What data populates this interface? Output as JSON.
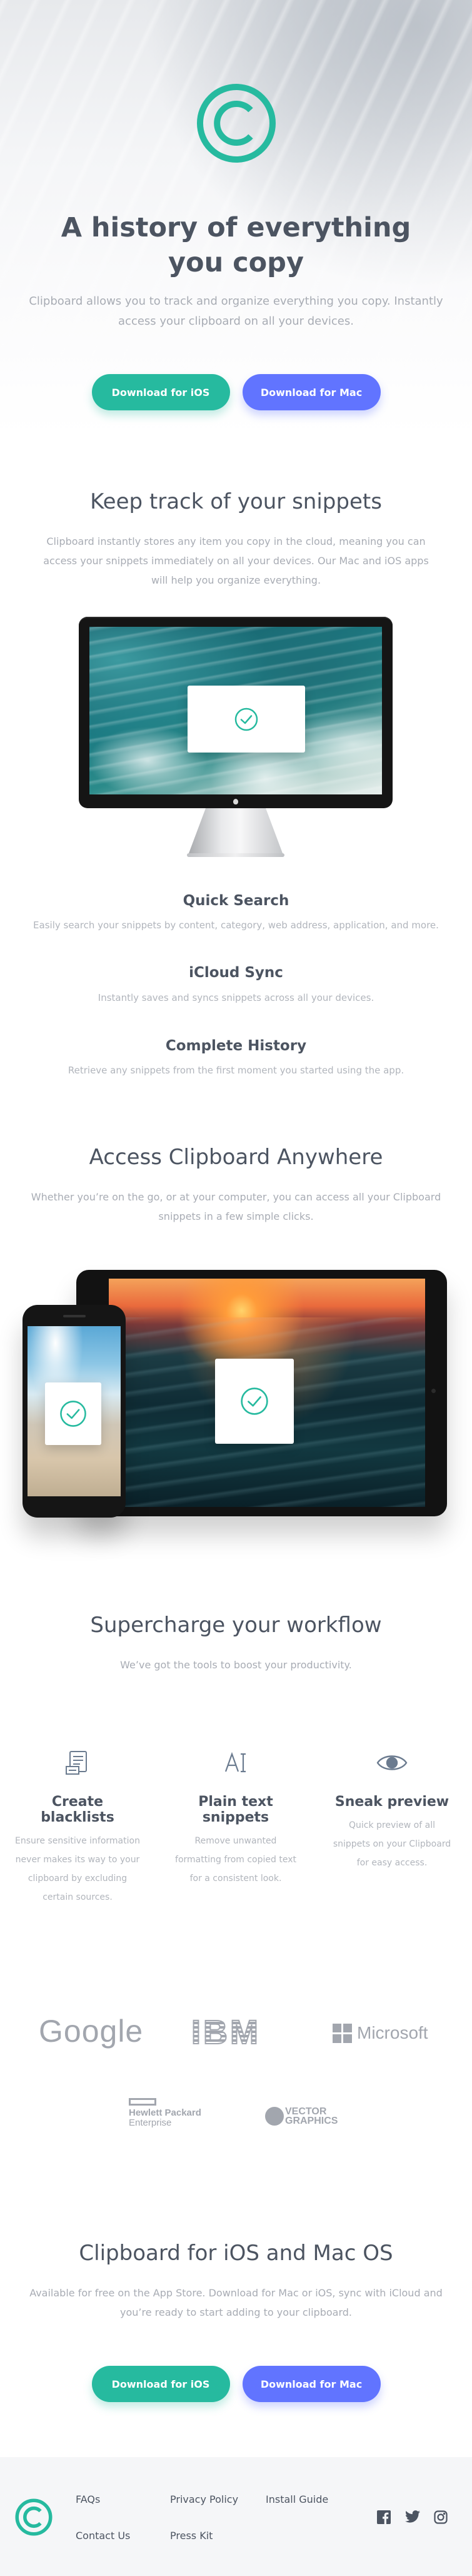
{
  "hero": {
    "title": "A history of everything you copy",
    "subtitle": "Clipboard allows you to track and organize everything you copy. Instantly access your clipboard on all your devices.",
    "btn_ios": "Download for iOS",
    "btn_mac": "Download for Mac"
  },
  "snippets": {
    "title": "Keep track of your snippets",
    "text": "Clipboard instantly stores any item you copy in the cloud, meaning you can access your snippets immediately on all your devices. Our Mac and iOS apps will help you organize everything.",
    "features": [
      {
        "title": "Quick Search",
        "text": "Easily search your snippets by content, category, web address, application, and more."
      },
      {
        "title": "iCloud Sync",
        "text": "Instantly saves and syncs snippets across all your devices."
      },
      {
        "title": "Complete History",
        "text": "Retrieve any snippets from the first moment you started using the app."
      }
    ]
  },
  "access": {
    "title": "Access Clipboard Anywhere",
    "text": "Whether you’re on the go, or at your computer, you can access all your Clipboard snippets in a few simple clicks."
  },
  "workflow": {
    "title": "Supercharge your workflow",
    "text": "We’ve got the tools to boost your productivity.",
    "items": [
      {
        "icon": "blacklist-icon",
        "title": "Create blacklists",
        "text": "Ensure sensitive information never makes its way to your clipboard by excluding certain sources."
      },
      {
        "icon": "text-icon",
        "title": "Plain text snippets",
        "text": "Remove unwanted formatting from copied text for a consistent look."
      },
      {
        "icon": "eye-icon",
        "title": "Sneak preview",
        "text": "Quick preview of all snippets on your Clipboard for easy access."
      }
    ]
  },
  "partners": {
    "google": "Google",
    "ibm": "IBM",
    "microsoft": "Microsoft",
    "hp_line1": "Hewlett Packard",
    "hp_line2": "Enterprise",
    "vector_line1": "VECTOR",
    "vector_line2": "GRAPHICS"
  },
  "cta": {
    "title": "Clipboard for iOS and Mac OS",
    "text": "Available for free on the App Store. Download for Mac or iOS, sync with iCloud and you’re ready to start adding to your clipboard.",
    "btn_ios": "Download for iOS",
    "btn_mac": "Download for Mac"
  },
  "footer": {
    "links": [
      "FAQs",
      "Privacy Policy",
      "Install Guide",
      "Contact Us",
      "Press Kit"
    ],
    "social": [
      "facebook-icon",
      "twitter-icon",
      "instagram-icon"
    ]
  },
  "colors": {
    "accent_green": "#26ba9f",
    "accent_blue": "#6174ff",
    "heading": "#4c5461",
    "body_text": "#a8acb4",
    "footer_bg": "#f5f6f8"
  }
}
